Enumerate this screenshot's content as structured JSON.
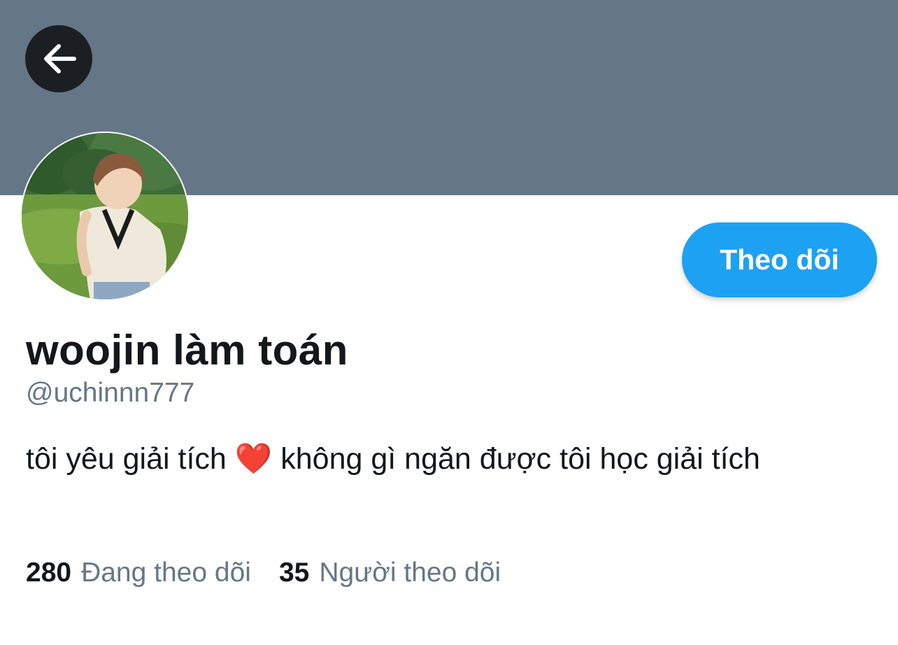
{
  "profile": {
    "display_name": "woojin làm toán",
    "handle": "@uchinnn777",
    "bio": "tôi yêu giải tích ❤️  không gì ngăn được tôi học giải tích",
    "follow_label": "Theo dõi"
  },
  "stats": {
    "following_count": "280",
    "following_label": "Đang theo dõi",
    "followers_count": "35",
    "followers_label": "Người theo dõi"
  },
  "icons": {
    "back": "arrow-left-icon",
    "avatar": "avatar-photo"
  },
  "colors": {
    "banner": "#657786",
    "accent": "#1da1f2",
    "text_primary": "#14171a",
    "text_secondary": "#657786",
    "back_button": "#1b1f23"
  }
}
